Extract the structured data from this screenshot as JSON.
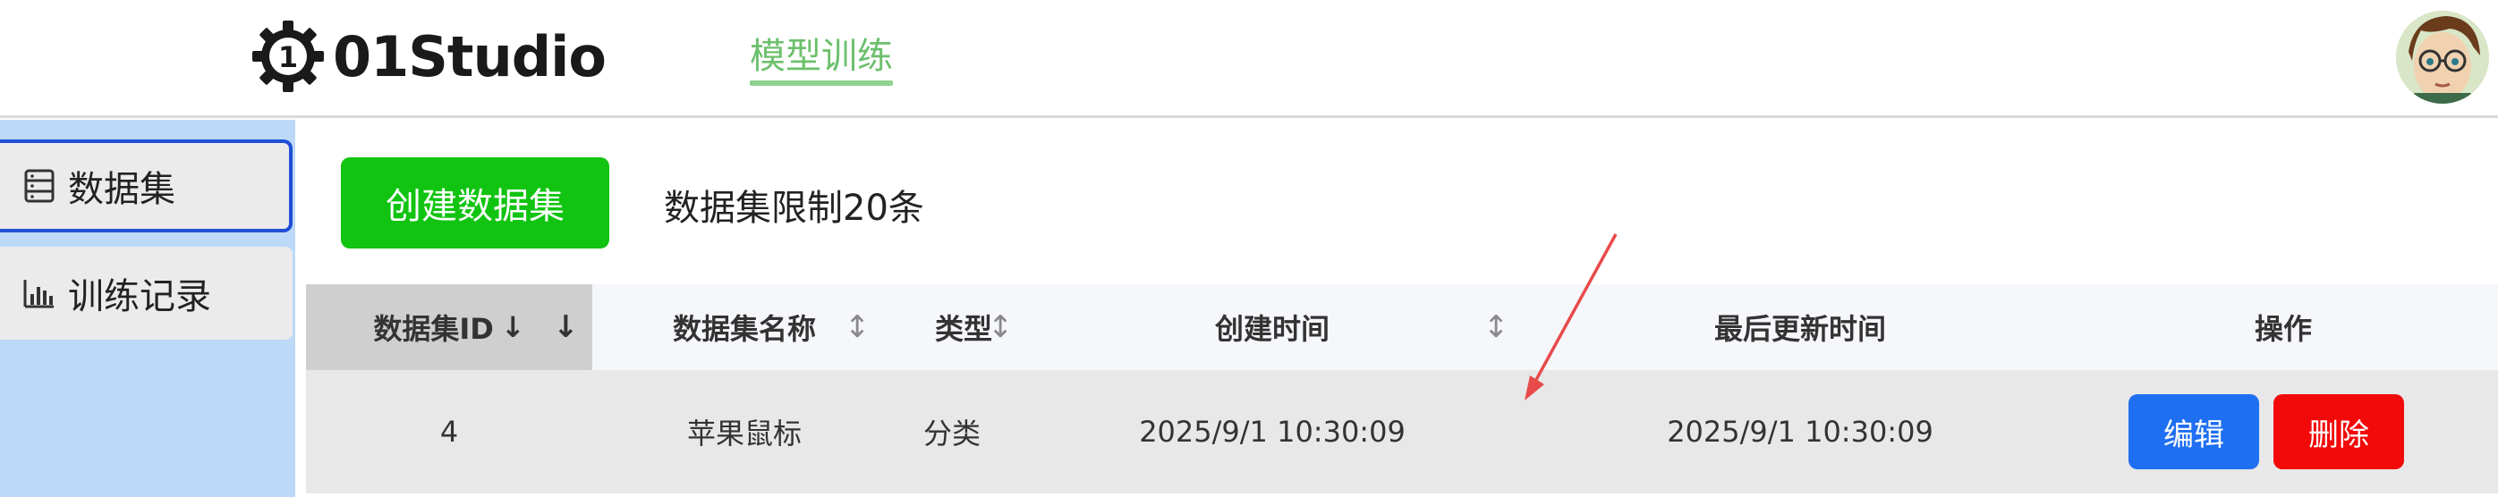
{
  "header": {
    "logo_text": "01Studio",
    "logo_badge": "1",
    "nav_tab": "模型训练"
  },
  "sidebar": {
    "items": [
      {
        "label": "数据集",
        "icon": "list-icon"
      },
      {
        "label": "训练记录",
        "icon": "bar-chart-icon"
      }
    ]
  },
  "toolbar": {
    "create_label": "创建数据集",
    "limit_text": "数据集限制20条"
  },
  "table": {
    "columns": {
      "id": "数据集ID",
      "id_sort": "↓",
      "name": "数据集名称",
      "type": "类型",
      "created": "创建时间",
      "updated": "最后更新时间",
      "actions": "操作"
    },
    "sort_glyph": "↕",
    "rows": [
      {
        "id": "4",
        "name": "苹果鼠标",
        "type": "分类",
        "created": "2025/9/1 10:30:09",
        "updated": "2025/9/1 10:30:09",
        "edit_label": "编辑",
        "delete_label": "删除"
      }
    ]
  },
  "colors": {
    "accent_green": "#11c411",
    "nav_green": "#6cc06c",
    "sidebar_bg": "#bcd9f7",
    "edit_blue": "#1f6ff2",
    "delete_red": "#f20909",
    "annotation_red": "#e84a4a"
  }
}
